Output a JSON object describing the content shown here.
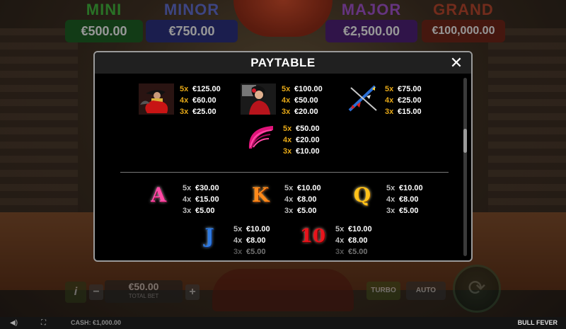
{
  "jackpots": {
    "mini": {
      "name": "MINI",
      "value": "€500.00"
    },
    "minor": {
      "name": "MINOR",
      "value": "€750.00"
    },
    "major": {
      "name": "MAJOR",
      "value": "€2,500.00"
    },
    "grand": {
      "name": "GRAND",
      "value": "€100,000.00"
    }
  },
  "controls": {
    "info": "i",
    "minus": "−",
    "plus": "+",
    "bet_value": "€50.00",
    "bet_label": "TOTAL BET",
    "turbo": "TURBO",
    "auto": "AUTO"
  },
  "bottom_bar": {
    "cash": "CASH: €1,000.00",
    "game_name": "BULL FEVER"
  },
  "paytable": {
    "title": "PAYTABLE",
    "close_glyph": "✕",
    "high_symbols": [
      {
        "name": "matador",
        "pays": [
          {
            "mult": "5x",
            "amount": "€125.00"
          },
          {
            "mult": "4x",
            "amount": "€60.00"
          },
          {
            "mult": "3x",
            "amount": "€25.00"
          }
        ]
      },
      {
        "name": "flamenco-dancer",
        "pays": [
          {
            "mult": "5x",
            "amount": "€100.00"
          },
          {
            "mult": "4x",
            "amount": "€50.00"
          },
          {
            "mult": "3x",
            "amount": "€20.00"
          }
        ]
      },
      {
        "name": "banderillas",
        "pays": [
          {
            "mult": "5x",
            "amount": "€75.00"
          },
          {
            "mult": "4x",
            "amount": "€25.00"
          },
          {
            "mult": "3x",
            "amount": "€15.00"
          }
        ]
      },
      {
        "name": "fan",
        "pays": [
          {
            "mult": "5x",
            "amount": "€50.00"
          },
          {
            "mult": "4x",
            "amount": "€20.00"
          },
          {
            "mult": "3x",
            "amount": "€10.00"
          }
        ]
      }
    ],
    "low_symbols": [
      {
        "name": "A",
        "pays": [
          {
            "mult": "5x",
            "amount": "€30.00"
          },
          {
            "mult": "4x",
            "amount": "€15.00"
          },
          {
            "mult": "3x",
            "amount": "€5.00"
          }
        ]
      },
      {
        "name": "K",
        "pays": [
          {
            "mult": "5x",
            "amount": "€10.00"
          },
          {
            "mult": "4x",
            "amount": "€8.00"
          },
          {
            "mult": "3x",
            "amount": "€5.00"
          }
        ]
      },
      {
        "name": "Q",
        "pays": [
          {
            "mult": "5x",
            "amount": "€10.00"
          },
          {
            "mult": "4x",
            "amount": "€8.00"
          },
          {
            "mult": "3x",
            "amount": "€5.00"
          }
        ]
      },
      {
        "name": "J",
        "pays": [
          {
            "mult": "5x",
            "amount": "€10.00"
          },
          {
            "mult": "4x",
            "amount": "€8.00"
          },
          {
            "mult": "3x",
            "amount": "€5.00"
          }
        ]
      },
      {
        "name": "10",
        "pays": [
          {
            "mult": "5x",
            "amount": "€10.00"
          },
          {
            "mult": "4x",
            "amount": "€8.00"
          },
          {
            "mult": "3x",
            "amount": "€5.00"
          }
        ]
      }
    ],
    "scroll_position": 0.33
  }
}
